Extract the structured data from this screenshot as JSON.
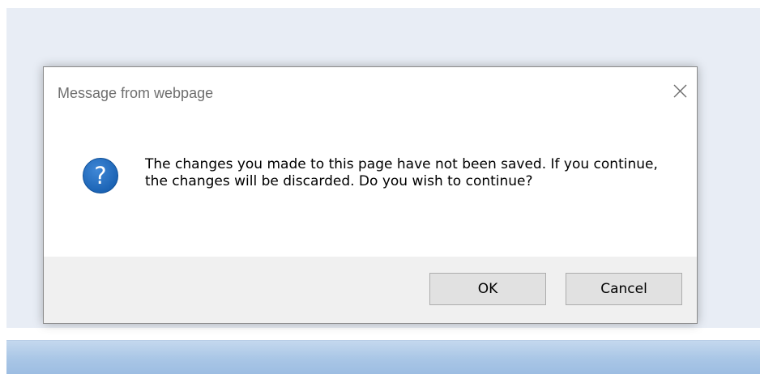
{
  "dialog": {
    "title": "Message from webpage",
    "message": "The changes you made to this page have not been saved.  If you continue, the changes will be discarded.  Do you wish to continue?",
    "icon": "question-icon",
    "close_icon": "close-icon",
    "ok_label": "OK",
    "cancel_label": "Cancel"
  },
  "colors": {
    "page_background": "#e8edf5",
    "taskbar_gradient_top": "#c4d8ee",
    "taskbar_gradient_bottom": "#9dbde2",
    "dialog_body": "#ffffff",
    "dialog_footer": "#f0f0f0",
    "question_icon_fill": "#1a62b3",
    "button_face": "#e1e1e1",
    "button_border": "#adadad",
    "title_text": "#6f6f6f"
  }
}
